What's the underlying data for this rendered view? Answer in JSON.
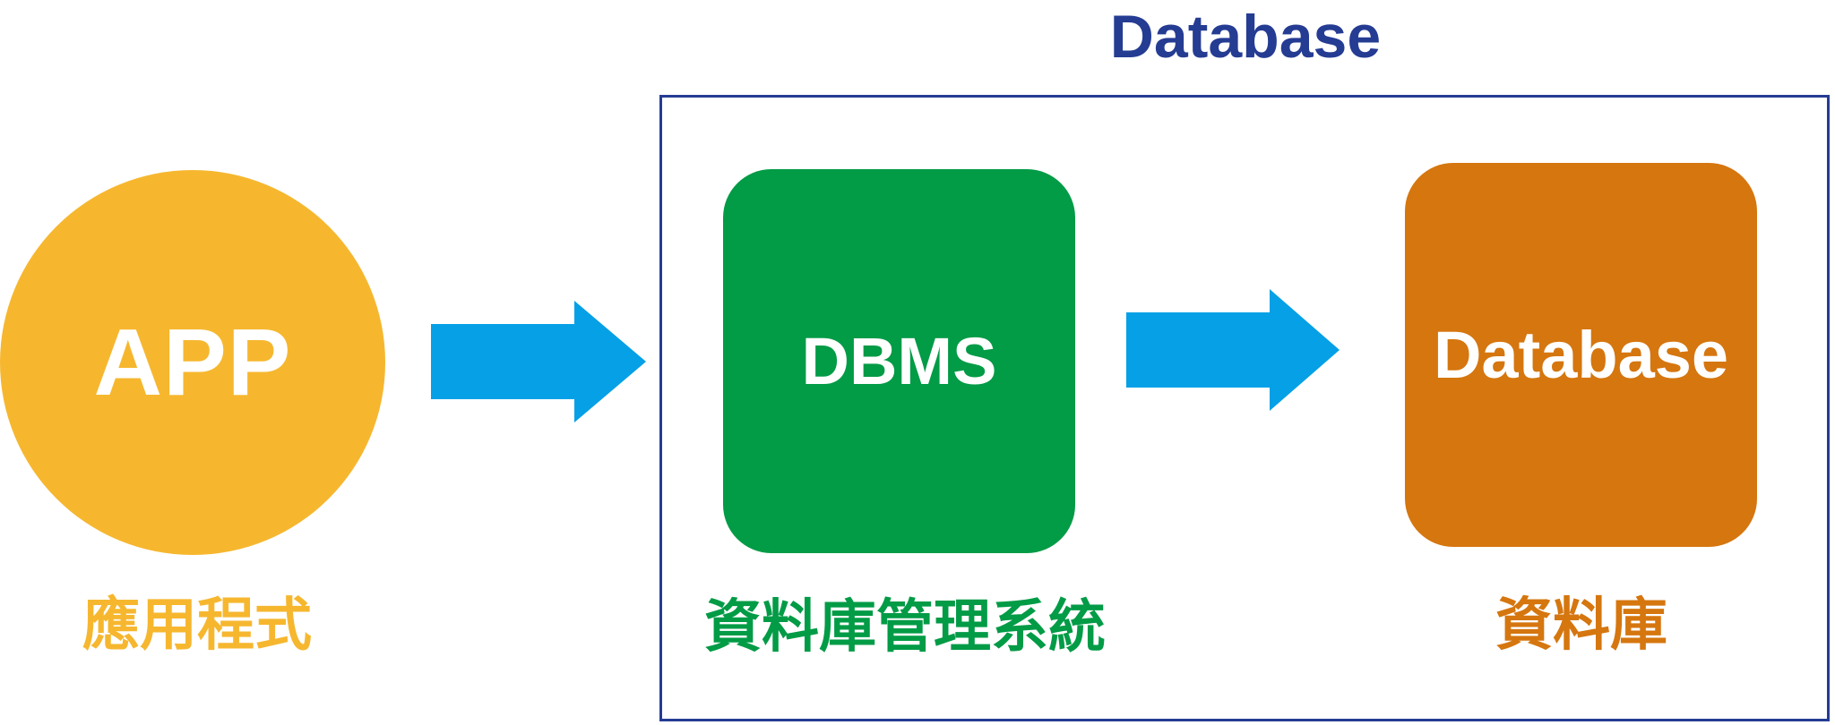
{
  "group": {
    "title": "Database"
  },
  "nodes": {
    "app": {
      "label": "APP",
      "caption": "應用程式",
      "color": "#f6b72f"
    },
    "dbms": {
      "label": "DBMS",
      "caption": "資料庫管理系統",
      "color": "#029b46"
    },
    "database": {
      "label": "Database",
      "caption": "資料庫",
      "color": "#d5760f"
    }
  },
  "colors": {
    "arrow": "#05a0e6",
    "group_border": "#253c93",
    "group_title": "#253c93"
  }
}
